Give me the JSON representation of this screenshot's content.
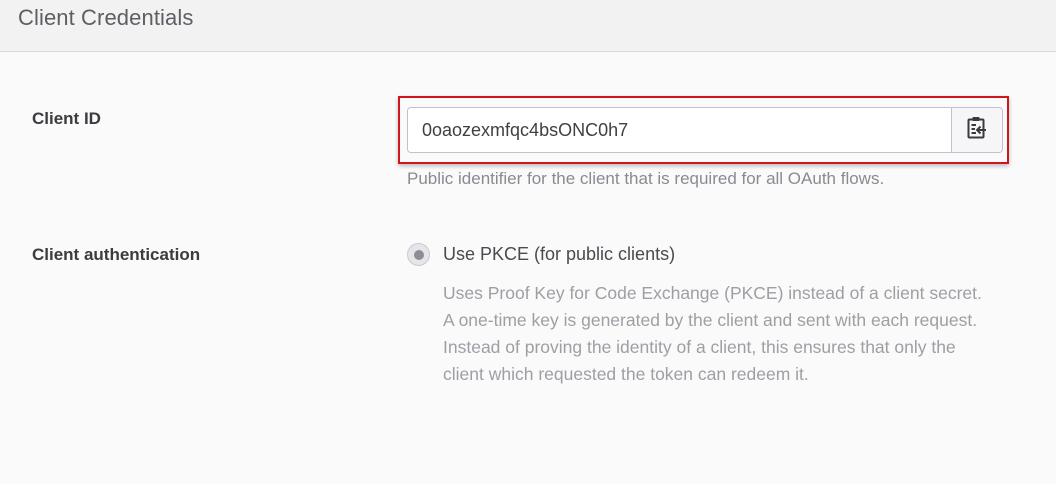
{
  "panel": {
    "title": "Client Credentials"
  },
  "client_id": {
    "label": "Client ID",
    "value": "0oaozexmfqc4bsONC0h7",
    "help": "Public identifier for the client that is required for all OAuth flows.",
    "copy_icon": "clipboard-copy-icon"
  },
  "client_authentication": {
    "label": "Client authentication",
    "option_label": "Use PKCE (for public clients)",
    "option_selected": true,
    "option_description": "Uses Proof Key for Code Exchange (PKCE) instead of a client secret. A one-time key is generated by the client and sent with each request. Instead of proving the identity of a client, this ensures that only the client which requested the token can redeem it."
  },
  "colors": {
    "highlight_border": "#d0161a"
  }
}
